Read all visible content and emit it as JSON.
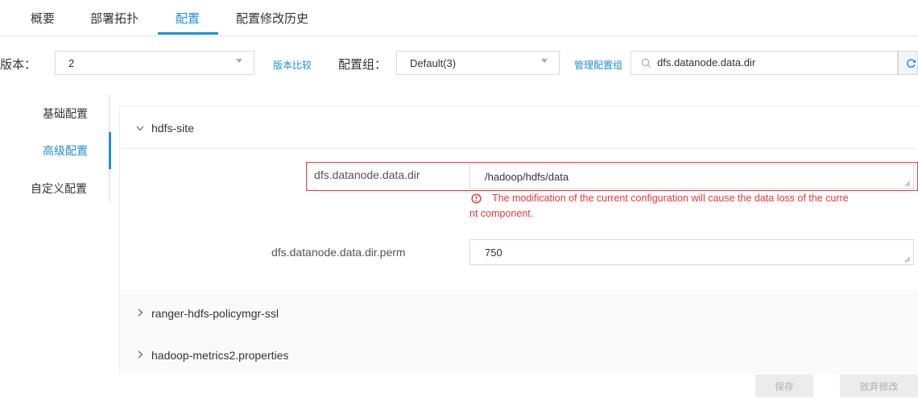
{
  "tabs": [
    {
      "label": "概要"
    },
    {
      "label": "部署拓扑"
    },
    {
      "label": "配置"
    },
    {
      "label": "配置修改历史"
    }
  ],
  "filters": {
    "version_label": "版本：",
    "version_value": "2",
    "compare_link": "版本比较",
    "group_label": "配置组：",
    "group_value": "Default(3)",
    "manage_link": "管理配置组",
    "search_value": "dfs.datanode.data.dir"
  },
  "nav": {
    "items": [
      {
        "label": "基础配置"
      },
      {
        "label": "高级配置"
      },
      {
        "label": "自定义配置"
      }
    ]
  },
  "sections": [
    {
      "name": "hdfs-site",
      "expanded": true
    },
    {
      "name": "ranger-hdfs-policymgr-ssl",
      "expanded": false
    },
    {
      "name": "hadoop-metrics2.properties",
      "expanded": false
    }
  ],
  "fields": [
    {
      "label": "dfs.datanode.data.dir",
      "value": "/hadoop/hdfs/data",
      "error_line1": "The modification of the current configuration will cause the data loss of the curre",
      "error_line2": "nt component."
    },
    {
      "label": "dfs.datanode.data.dir.perm",
      "value": "750"
    }
  ],
  "actions": {
    "save": "保存",
    "discard": "放弃修改"
  },
  "colors": {
    "accent": "#1e90d8",
    "error": "#e0383e",
    "highlight_border": "#e04040"
  }
}
